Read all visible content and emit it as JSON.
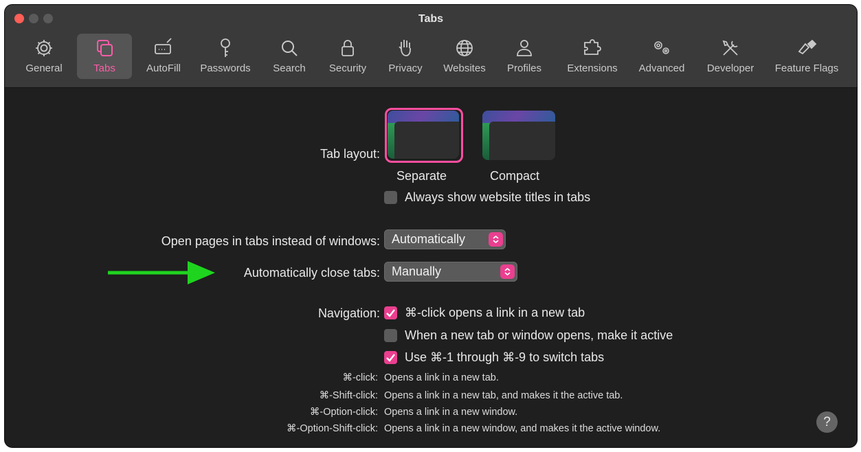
{
  "window": {
    "title": "Tabs"
  },
  "toolbar": [
    {
      "label": "General",
      "icon": "gear-icon"
    },
    {
      "label": "Tabs",
      "icon": "tabs-icon",
      "active": true
    },
    {
      "label": "AutoFill",
      "icon": "autofill-icon"
    },
    {
      "label": "Passwords",
      "icon": "key-icon"
    },
    {
      "label": "Search",
      "icon": "search-icon"
    },
    {
      "label": "Security",
      "icon": "lock-icon"
    },
    {
      "label": "Privacy",
      "icon": "hand-icon"
    },
    {
      "label": "Websites",
      "icon": "globe-icon"
    },
    {
      "label": "Profiles",
      "icon": "person-icon"
    },
    {
      "label": "Extensions",
      "icon": "puzzle-icon"
    },
    {
      "label": "Advanced",
      "icon": "gears-icon"
    },
    {
      "label": "Developer",
      "icon": "wrench-screwdriver-icon"
    },
    {
      "label": "Feature Flags",
      "icon": "flags-icon"
    }
  ],
  "tab_layout": {
    "label": "Tab layout:",
    "options": [
      "Separate",
      "Compact"
    ],
    "selected": "Separate",
    "always_show_titles": {
      "label": "Always show website titles in tabs",
      "checked": false
    }
  },
  "open_pages": {
    "label": "Open pages in tabs instead of windows:",
    "value": "Automatically"
  },
  "auto_close": {
    "label": "Automatically close tabs:",
    "value": "Manually"
  },
  "navigation": {
    "label": "Navigation:",
    "options": [
      {
        "label": "⌘-click opens a link in a new tab",
        "checked": true
      },
      {
        "label": "When a new tab or window opens, make it active",
        "checked": false
      },
      {
        "label": "Use ⌘-1 through ⌘-9 to switch tabs",
        "checked": true
      }
    ]
  },
  "shortcuts": [
    {
      "key": "⌘-click:",
      "desc": "Opens a link in a new tab."
    },
    {
      "key": "⌘-Shift-click:",
      "desc": "Opens a link in a new tab, and makes it the active tab."
    },
    {
      "key": "⌘-Option-click:",
      "desc": "Opens a link in a new window."
    },
    {
      "key": "⌘-Option-Shift-click:",
      "desc": "Opens a link in a new window, and makes it the active window."
    }
  ],
  "help": "?",
  "colors": {
    "accent": "#ea3f8f",
    "annotation_arrow": "#1fd41f",
    "background": "#1f1f1f",
    "toolbar": "#3a3a3a"
  }
}
